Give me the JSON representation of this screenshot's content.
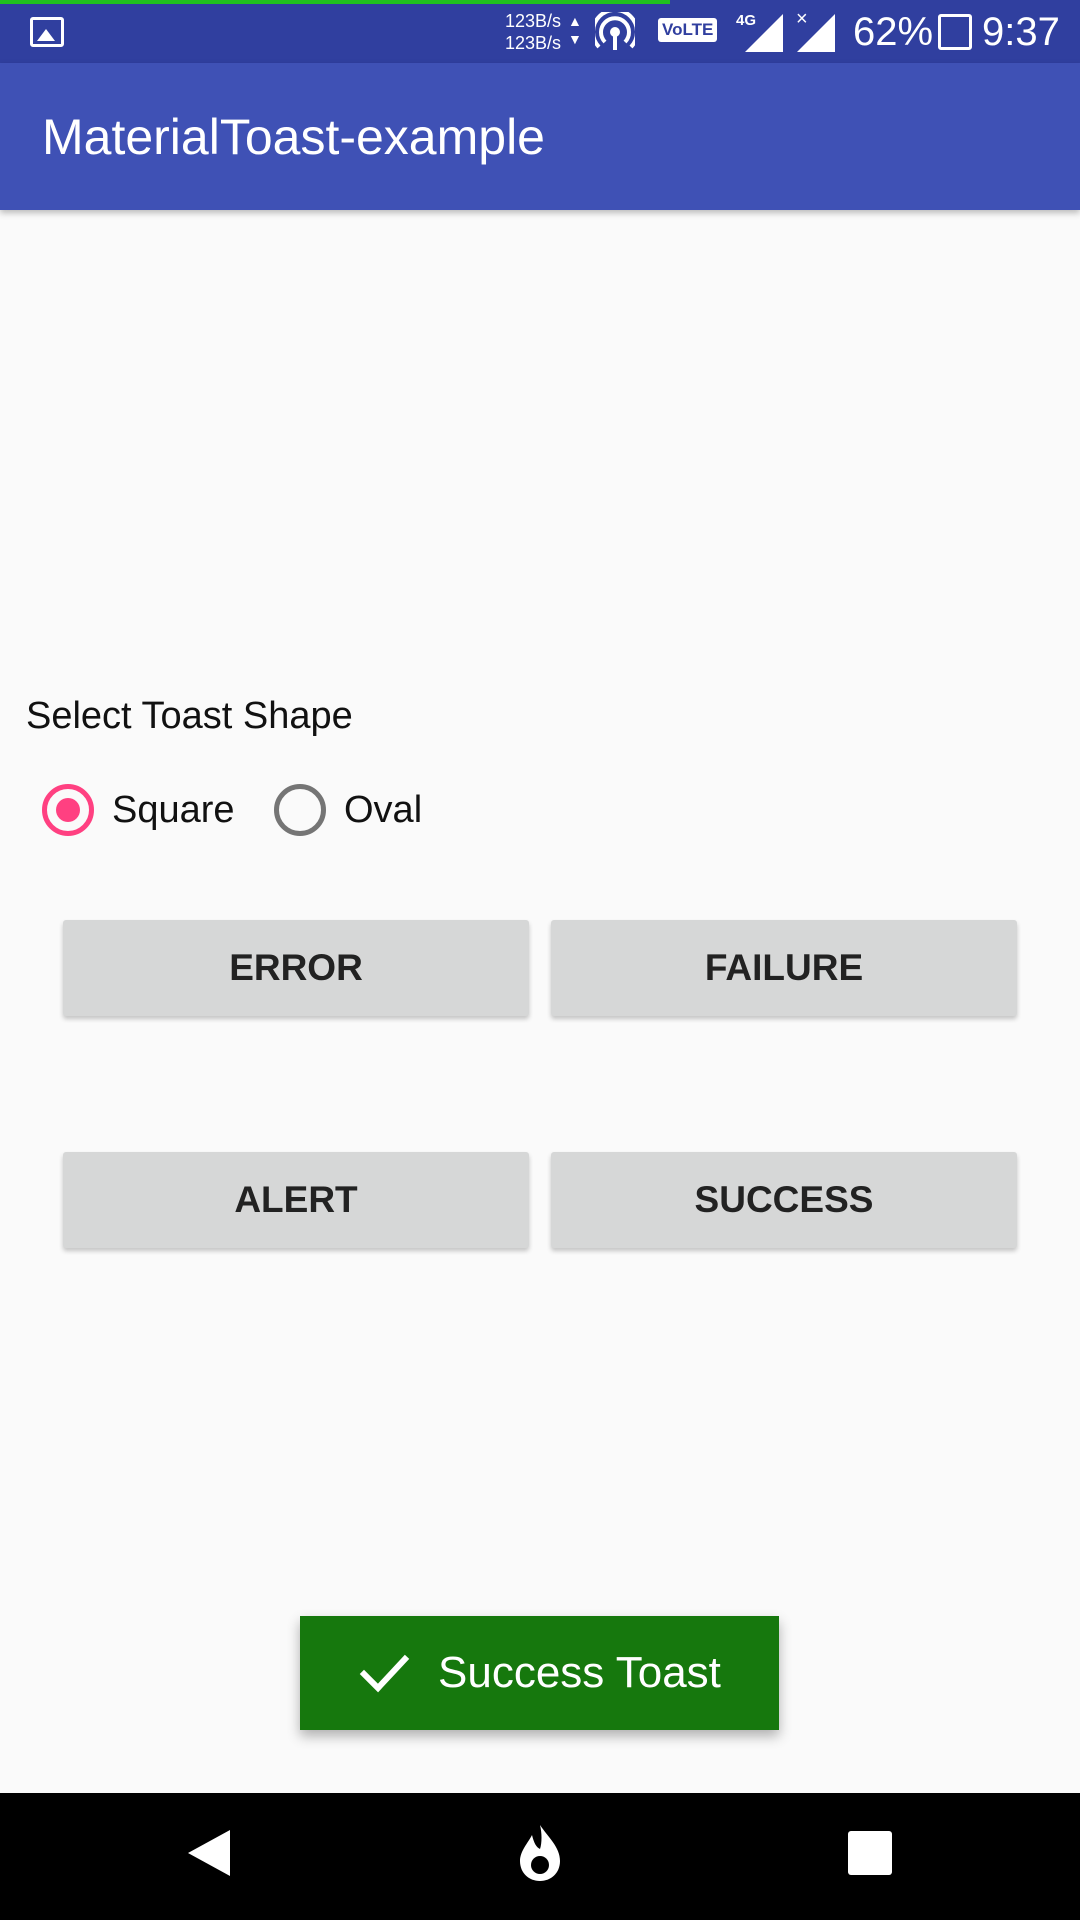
{
  "status_bar": {
    "net_speed_up": "123B/s",
    "net_speed_down": "123B/s",
    "volte": "VoLTE",
    "network": "4G",
    "battery_percent": "62%",
    "time": "9:37",
    "icons": [
      "gallery-icon",
      "hotspot-icon",
      "signal-icon",
      "battery-icon"
    ]
  },
  "app_bar": {
    "title": "MaterialToast-example",
    "color": "#3f51b5"
  },
  "shape_selector": {
    "label": "Select Toast Shape",
    "options": [
      {
        "label": "Square",
        "checked": true
      },
      {
        "label": "Oval",
        "checked": false
      }
    ],
    "accent_color": "#ff4081"
  },
  "buttons": {
    "error": "ERROR",
    "failure": "FAILURE",
    "alert": "ALERT",
    "success": "SUCCESS"
  },
  "toast": {
    "text": "Success Toast",
    "icon": "check-icon",
    "color": "#16780d"
  },
  "nav_bar": {
    "icons": [
      "back-icon",
      "home-icon",
      "recents-icon"
    ]
  }
}
